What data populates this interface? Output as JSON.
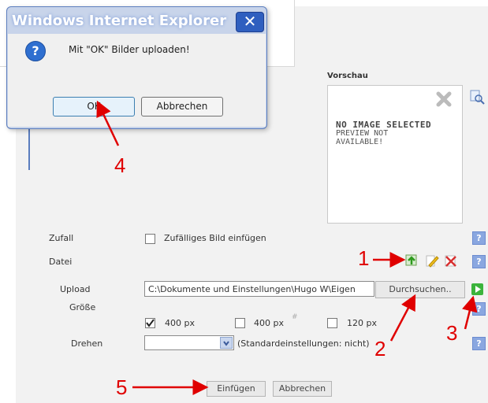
{
  "dialog": {
    "title": "Windows Internet Explorer",
    "close_glyph": "✕",
    "message": "Mit \"OK\" Bilder uploaden!",
    "ok_label": "OK",
    "cancel_label": "Abbrechen",
    "question_glyph": "?"
  },
  "preview": {
    "title": "Vorschau",
    "line1": "NO IMAGE SELECTED",
    "line2": "PREVIEW NOT",
    "line3": "AVAILABLE!"
  },
  "form": {
    "zufall_label": "Zufall",
    "zufall_option": "Zufälliges Bild einfügen",
    "datei_label": "Datei",
    "upload_label": "Upload",
    "upload_value": "C:\\Dokumente und Einstellungen\\Hugo W\\Eigen",
    "browse_label": "Durchsuchen..",
    "groesse_label": "Größe",
    "size1": "400 px",
    "size2": "400 px",
    "size3": "120 px",
    "size_sep": "#",
    "drehen_label": "Drehen",
    "drehen_hint": "(Standardeinstellungen: nicht)",
    "insert_label": "Einfügen",
    "cancel_label": "Abbrechen",
    "help_glyph": "?"
  },
  "annotations": [
    "1",
    "2",
    "3",
    "4",
    "5"
  ],
  "colors": {
    "accent": "#5d7fbf",
    "annotation": "#e00000",
    "help": "#8aa7e0"
  }
}
